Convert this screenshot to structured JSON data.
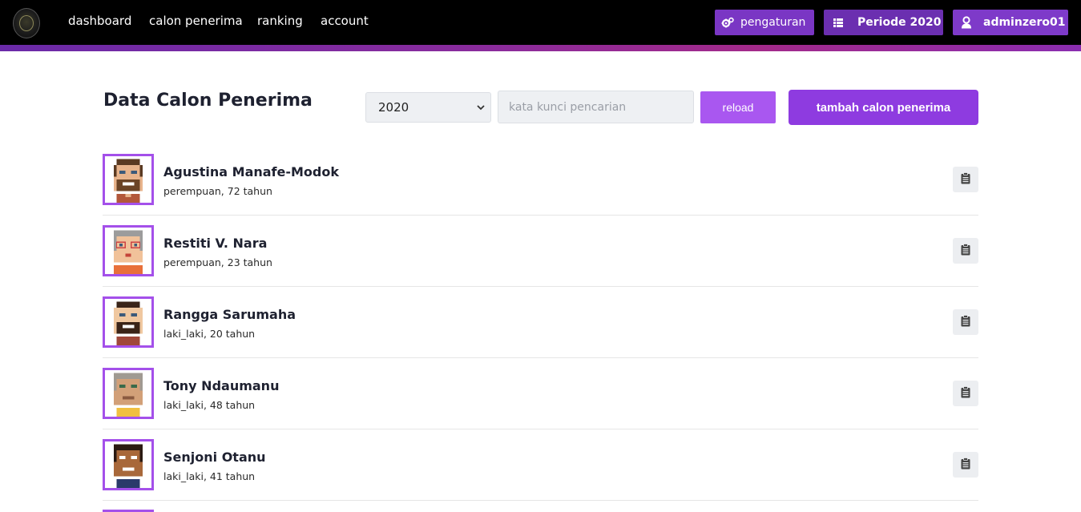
{
  "nav": {
    "links": [
      "dashboard",
      "calon penerima",
      "ranking",
      "account"
    ],
    "settings_label": "pengaturan",
    "period_label": "Periode 2020",
    "user_label": "adminzero01"
  },
  "header": {
    "title": "Data Calon Penerima",
    "year_selected": "2020",
    "search_placeholder": "kata kunci pencarian",
    "reload_label": "reload",
    "add_label": "tambah calon penerima"
  },
  "candidates": [
    {
      "name": "Agustina Manafe-Modok",
      "meta": "perempuan, 72 tahun"
    },
    {
      "name": "Restiti V. Nara",
      "meta": "perempuan, 23 tahun"
    },
    {
      "name": "Rangga Sarumaha",
      "meta": "laki_laki, 20 tahun"
    },
    {
      "name": "Tony Ndaumanu",
      "meta": "laki_laki, 48 tahun"
    },
    {
      "name": "Senjoni Otanu",
      "meta": "laki_laki, 41 tahun"
    }
  ],
  "icons": {
    "settings": "gears-icon",
    "period": "list-icon",
    "user": "user-icon",
    "detail": "clipboard-icon",
    "select": "chevron-down-icon"
  },
  "colors": {
    "accent": "#8e3be0",
    "avatar_border": "#a450ea"
  }
}
